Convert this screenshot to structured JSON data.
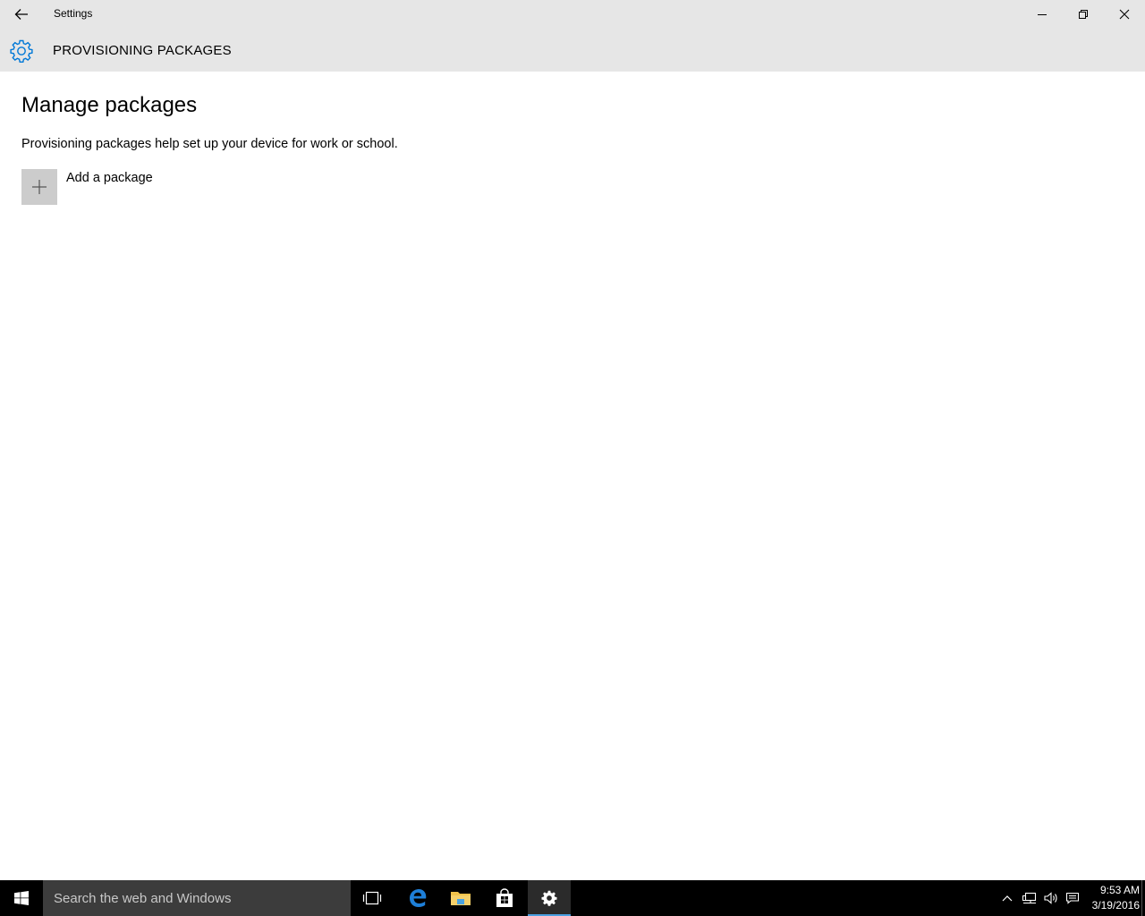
{
  "window": {
    "title": "Settings",
    "controls": {
      "minimize": "minimize",
      "restore": "restore",
      "close": "close"
    }
  },
  "header": {
    "title": "PROVISIONING PACKAGES",
    "icon": "gear-icon",
    "icon_color": "#0078d7"
  },
  "content": {
    "heading": "Manage packages",
    "description": "Provisioning packages help set up your device for work or school.",
    "add_package": {
      "label": "Add a package",
      "icon": "plus-icon"
    }
  },
  "taskbar": {
    "search_placeholder": "Search the web and Windows",
    "apps": [
      {
        "name": "task-view",
        "icon": "task-view-icon"
      },
      {
        "name": "edge",
        "icon": "edge-icon"
      },
      {
        "name": "file-explorer",
        "icon": "folder-icon"
      },
      {
        "name": "store",
        "icon": "store-icon"
      },
      {
        "name": "settings",
        "icon": "gear-icon",
        "active": true
      }
    ],
    "tray": [
      "chevron-up-icon",
      "network-icon",
      "volume-icon",
      "action-center-icon"
    ],
    "clock": {
      "time": "9:53 AM",
      "date": "3/19/2016"
    }
  },
  "colors": {
    "titlebar_bg": "#e6e6e6",
    "accent": "#0078d7",
    "taskbar_bg": "#000000",
    "search_bg": "#3c3c3c"
  }
}
